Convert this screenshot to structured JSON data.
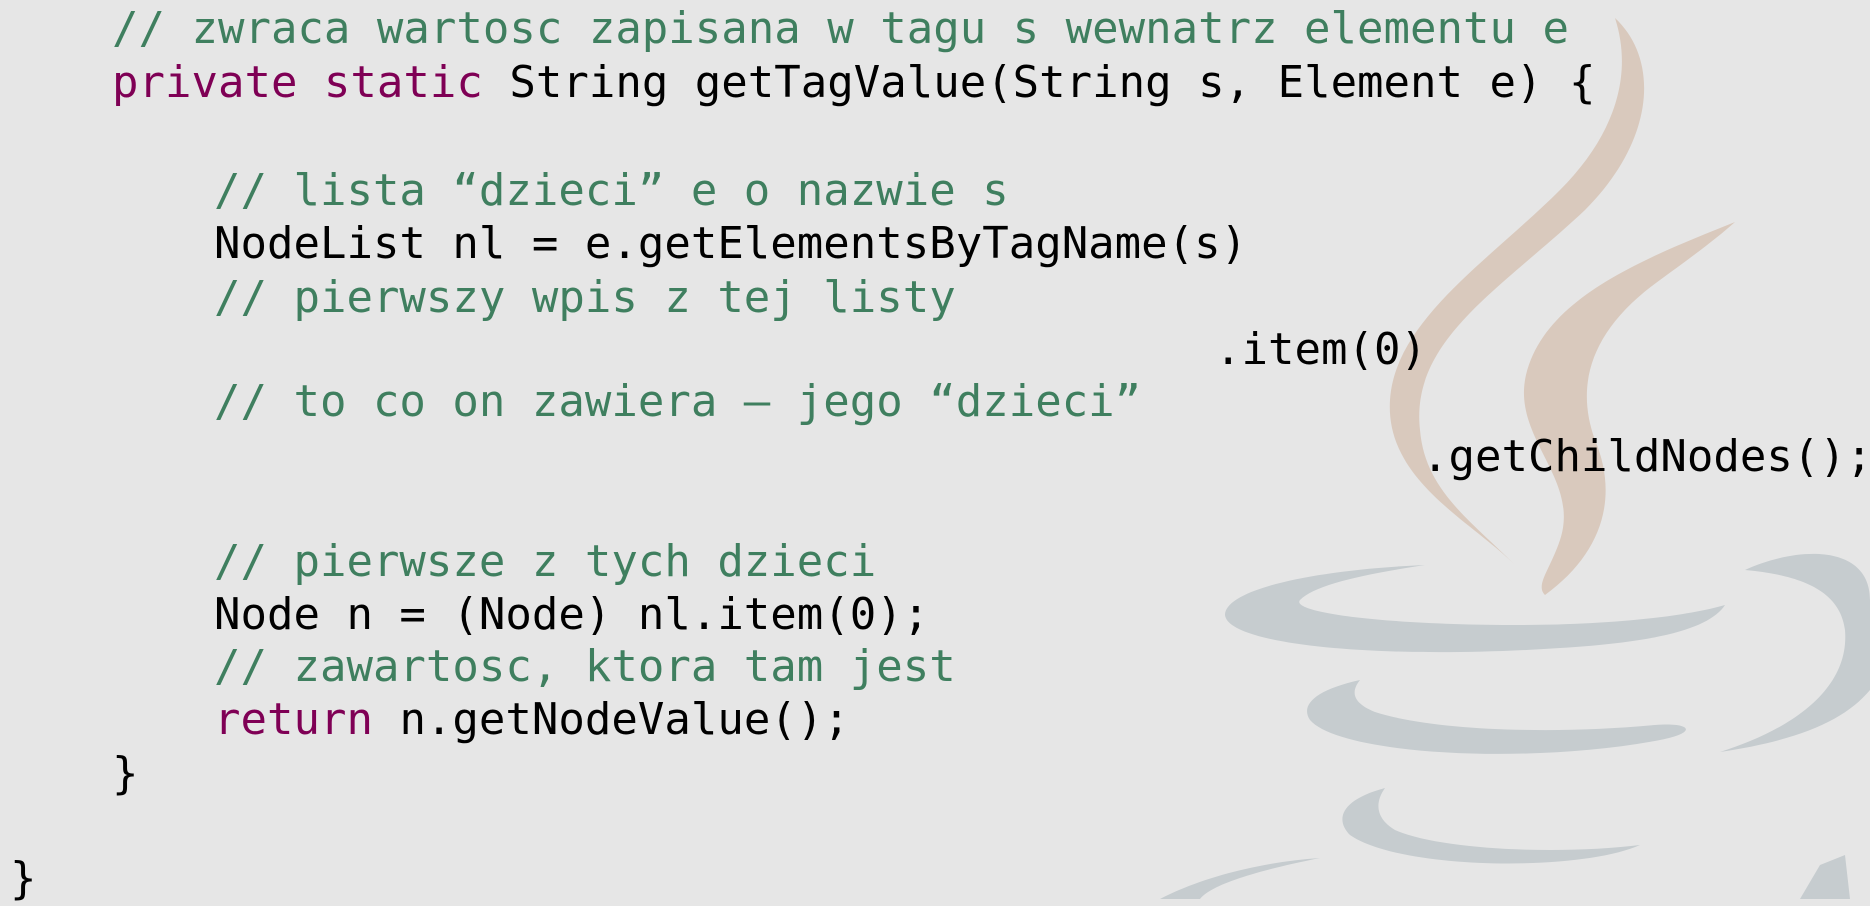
{
  "code": {
    "l1_comment": "// zwraca wartosc zapisana w tagu s wewnatrz elementu e",
    "l2_kw": "private static",
    "l2_rest": " String getTagValue(String s, Element e) {",
    "l3_comment": "// lista “dzieci” e o nazwie s",
    "l4_code": "NodeList nl = e.getElementsByTagName(s)",
    "l5_comment": "// pierwszy wpis z tej listy",
    "l6_code": ".item(0)",
    "l7_comment": "// to co on zawiera – jego “dzieci”",
    "l8_code": ".getChildNodes();",
    "l9_comment": "// pierwsze z tych dzieci",
    "l10_code": "Node n = (Node) nl.item(0);",
    "l11_comment": "// zawartosc, ktora tam jest",
    "l12_kw": "return",
    "l12_rest": " n.getNodeValue();",
    "l13_code": "}",
    "l14_code": "}"
  },
  "colors": {
    "background": "#e6e6e6",
    "comment": "#3f7f5f",
    "keyword": "#7f0055",
    "text": "#000000",
    "logo_steam": "#d9c9bd",
    "logo_cup": "#c6cccf"
  },
  "background_logo": "java-coffee-cup-icon"
}
